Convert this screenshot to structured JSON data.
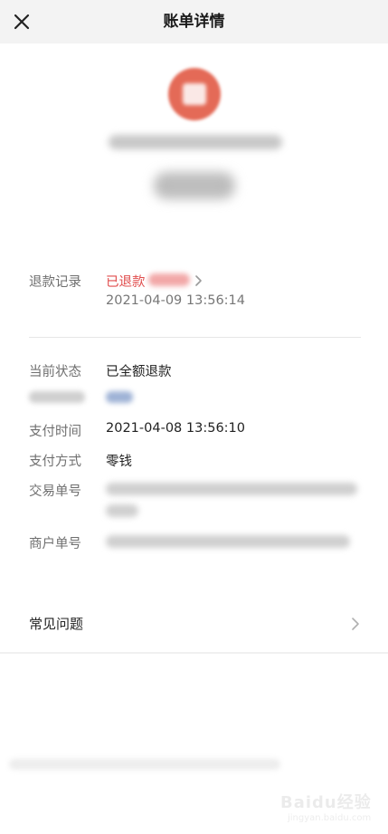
{
  "header": {
    "title": "账单详情",
    "close_icon": "close-icon"
  },
  "summary": {
    "avatar_color": "#e46a57"
  },
  "refund": {
    "label": "退款记录",
    "status": "已退款",
    "time": "2021-04-09 13:56:14",
    "status_color": "#e04c4c"
  },
  "details": {
    "status_label": "当前状态",
    "status_value": "已全额退款",
    "pay_time_label": "支付时间",
    "pay_time_value": "2021-04-08 13:56:10",
    "pay_method_label": "支付方式",
    "pay_method_value": "零钱",
    "txn_label": "交易单号",
    "merchant_no_label": "商户单号"
  },
  "faq": {
    "label": "常见问题",
    "chevron_icon": "chevron-right-icon"
  },
  "watermark": {
    "brand": "Baidu经验",
    "sub": "jingyan.baidu.com"
  }
}
